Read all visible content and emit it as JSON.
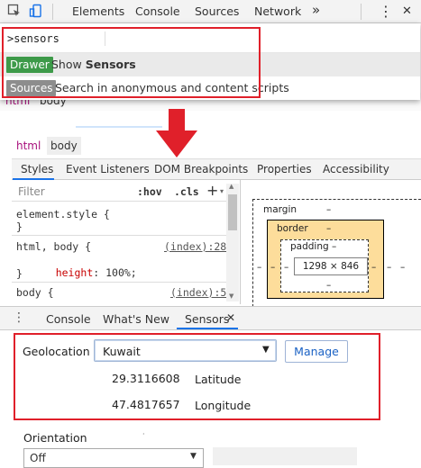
{
  "toolbar": {
    "tabs": [
      "Elements",
      "Console",
      "Sources",
      "Network"
    ],
    "more": "»",
    "kebab": "⋮",
    "close": "✕"
  },
  "command_menu": {
    "input": ">sensors",
    "results": [
      {
        "badge": "Drawer",
        "badge_color": "#3d9a49",
        "pre": "Show ",
        "bold": "Sensors"
      },
      {
        "badge": "Sources",
        "badge_color": "#8d8d8d",
        "pre": "Search in anonymous and content scripts"
      }
    ]
  },
  "background_crumbs": [
    "html",
    "body"
  ],
  "elements": {
    "crumbs": [
      "html",
      "body"
    ],
    "subtabs": [
      "Styles",
      "Event Listeners",
      "DOM Breakpoints",
      "Properties",
      "Accessibility"
    ],
    "filter_placeholder": "Filter",
    "hov": ":hov",
    "cls": ".cls",
    "add": "+",
    "rules": {
      "element_style": "element.style {",
      "close1": "}",
      "html_body": "html, body {",
      "html_body_link": "(index):28",
      "prop_name": "height",
      "prop_value": "100%;",
      "close2": "}",
      "body": "body {",
      "body_link": "(index):5"
    },
    "box_model": {
      "margin_label": "margin",
      "margin_val": "–",
      "border_label": "border",
      "border_val": "–",
      "padding_label": "padding –",
      "content": "1298 × 846",
      "dash": "–"
    }
  },
  "drawer": {
    "tabs": [
      "Console",
      "What's New",
      "Sensors"
    ],
    "close": "✕",
    "geolocation_label": "Geolocation",
    "location": "Kuwait",
    "manage": "Manage",
    "latitude_value": "29.3116608",
    "latitude_label": "Latitude",
    "longitude_value": "47.4817657",
    "longitude_label": "Longitude",
    "orientation_label": "Orientation",
    "orientation_value": "Off"
  },
  "colors": {
    "annotation_red": "#e0202a",
    "accent_blue": "#1a73e8",
    "css_property": "#c80000"
  }
}
